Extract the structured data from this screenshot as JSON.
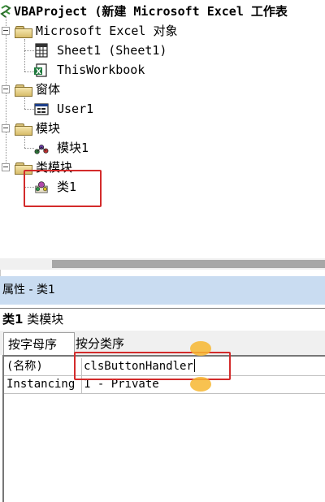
{
  "project_tree": {
    "root_label": "VBAProject (新建 Microsoft Excel 工作表",
    "folders": {
      "excel_objects": "Microsoft Excel 对象",
      "forms": "窗体",
      "modules": "模块",
      "class_modules": "类模块"
    },
    "items": {
      "sheet1": "Sheet1 (Sheet1)",
      "thisworkbook": "ThisWorkbook",
      "user1": "User1",
      "module1": "模块1",
      "class1": "类1"
    }
  },
  "properties": {
    "title": "属性 - 类1",
    "object_name": "类1",
    "object_type": "类模块",
    "tabs": [
      "按字母序",
      "按分类序"
    ],
    "rows": [
      {
        "name": "(名称)",
        "value": "clsButtonHandler"
      },
      {
        "name": "Instancing",
        "value": "1 - Private"
      }
    ]
  },
  "colors": {
    "title_bar": "#c9dcf1",
    "highlight_box": "#d32b2b",
    "marker_dot": "#f7b731"
  },
  "icons": [
    "folder-icon",
    "sheet-icon",
    "workbook-icon",
    "userform-icon",
    "module-icon",
    "class-module-icon"
  ]
}
